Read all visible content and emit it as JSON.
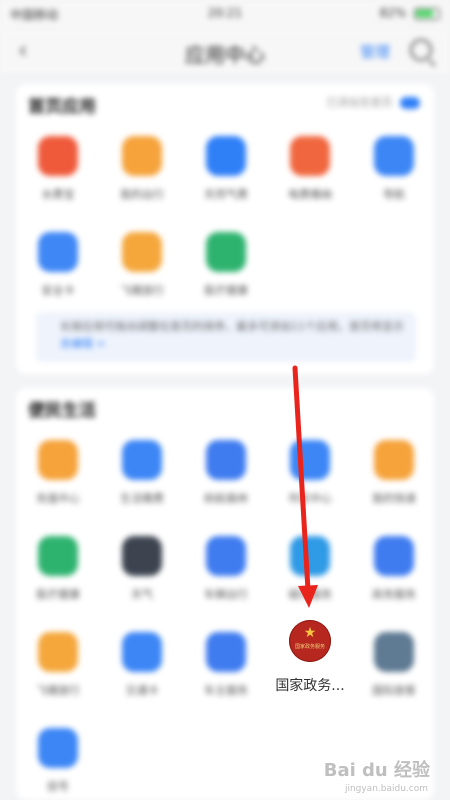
{
  "status_bar": {
    "carrier": "中国移动",
    "time": "20:21",
    "battery": "82%"
  },
  "nav": {
    "back_icon": "chevron-left-icon",
    "title": "应用中心",
    "manage_label": "管理",
    "search_icon": "search-icon"
  },
  "section_home": {
    "title": "首页应用",
    "hint": "已添加至首页",
    "apps": [
      {
        "label": "水费宝",
        "color": "#ef5a3b"
      },
      {
        "label": "我的出行",
        "color": "#f6a33b"
      },
      {
        "label": "天然气费",
        "color": "#2f7ff7"
      },
      {
        "label": "电费缴纳",
        "color": "#f0673f"
      },
      {
        "label": "导航",
        "color": "#3c86f5"
      },
      {
        "label": "安全卡",
        "color": "#3f87f5"
      },
      {
        "label": "飞猪旅行",
        "color": "#f5a73c"
      },
      {
        "label": "医疗健康",
        "color": "#2eb36f"
      }
    ],
    "notice_text": "长按应用可拖动调整在首页的排序，最多可添加11个应用，首页将显示",
    "notice_link": "去编辑 >"
  },
  "section_life": {
    "title": "便民生活",
    "apps": [
      {
        "label": "充值中心",
        "color": "#f6a33b"
      },
      {
        "label": "生活缴费",
        "color": "#3c86f5"
      },
      {
        "label": "蚂蚁森林",
        "color": "#3f7cf0"
      },
      {
        "label": "市民中心",
        "color": "#3c86f5"
      },
      {
        "label": "我的快递",
        "color": "#f6a33b"
      },
      {
        "label": "医疗健康",
        "color": "#2eb36f"
      },
      {
        "label": "天气",
        "color": "#3d4450"
      },
      {
        "label": "车辆出行",
        "color": "#3f7cf0"
      },
      {
        "label": "城市服务",
        "color": "#2f9ae6"
      },
      {
        "label": "政务服务",
        "color": "#3f7cf0"
      },
      {
        "label": "飞猪旅行",
        "color": "#f5a73c"
      },
      {
        "label": "交通卡",
        "color": "#3c86f5"
      },
      {
        "label": "车主服务",
        "color": "#3f7cf0"
      },
      {
        "label": "国家政务...",
        "color": "#b5271f"
      },
      {
        "label": "国际旅客",
        "color": "#5f7a93"
      },
      {
        "label": "挂号",
        "color": "#3c86f5"
      }
    ]
  },
  "highlight_app": {
    "label": "国家政务...",
    "emblem_text": "国家政务服务",
    "icon": "national-emblem-icon"
  },
  "watermark": {
    "brand": "Bai du 经验",
    "sub": "jingyan.baidu.com"
  },
  "colors": {
    "accent": "#2f7ff7",
    "arrow": "#e8241d"
  }
}
